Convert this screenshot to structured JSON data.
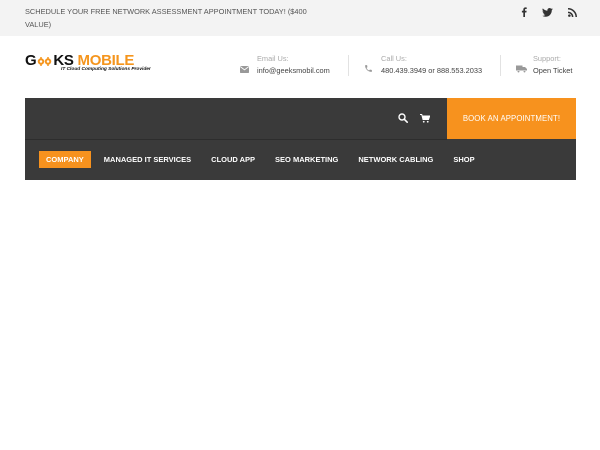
{
  "topbar": {
    "promo_line1": "SCHEDULE YOUR FREE NETWORK ASSESSMENT APPOINTMENT TODAY! ($400",
    "promo_line2": "VALUE)",
    "social": [
      "facebook-icon",
      "twitter-icon",
      "rss-icon"
    ]
  },
  "logo": {
    "brand_prefix": "G",
    "brand_suffix": "KS",
    "brand_second": "MOBILE",
    "tagline": "IT Cloud Computing Solutions Provider"
  },
  "contacts": [
    {
      "icon": "envelope-icon",
      "label": "Email Us:",
      "value": "info@geeksmobil.com"
    },
    {
      "icon": "phone-icon",
      "label": "Call Us:",
      "value": "480.439.3949 or 888.553.2033"
    },
    {
      "icon": "truck-icon",
      "label": "Support:",
      "value": "Open Ticket"
    }
  ],
  "nav": {
    "book_label": "BOOK AN APPOINTMENT!",
    "items": [
      {
        "label": "COMPANY",
        "active": true
      },
      {
        "label": "MANAGED IT SERVICES",
        "active": false
      },
      {
        "label": "CLOUD APP",
        "active": false
      },
      {
        "label": "SEO MARKETING",
        "active": false
      },
      {
        "label": "NETWORK CABLING",
        "active": false
      },
      {
        "label": "SHOP",
        "active": false
      }
    ]
  },
  "colors": {
    "accent": "#f7921e",
    "nav_bg": "#3a3a3a",
    "topbar_bg": "#f3f3f3"
  }
}
